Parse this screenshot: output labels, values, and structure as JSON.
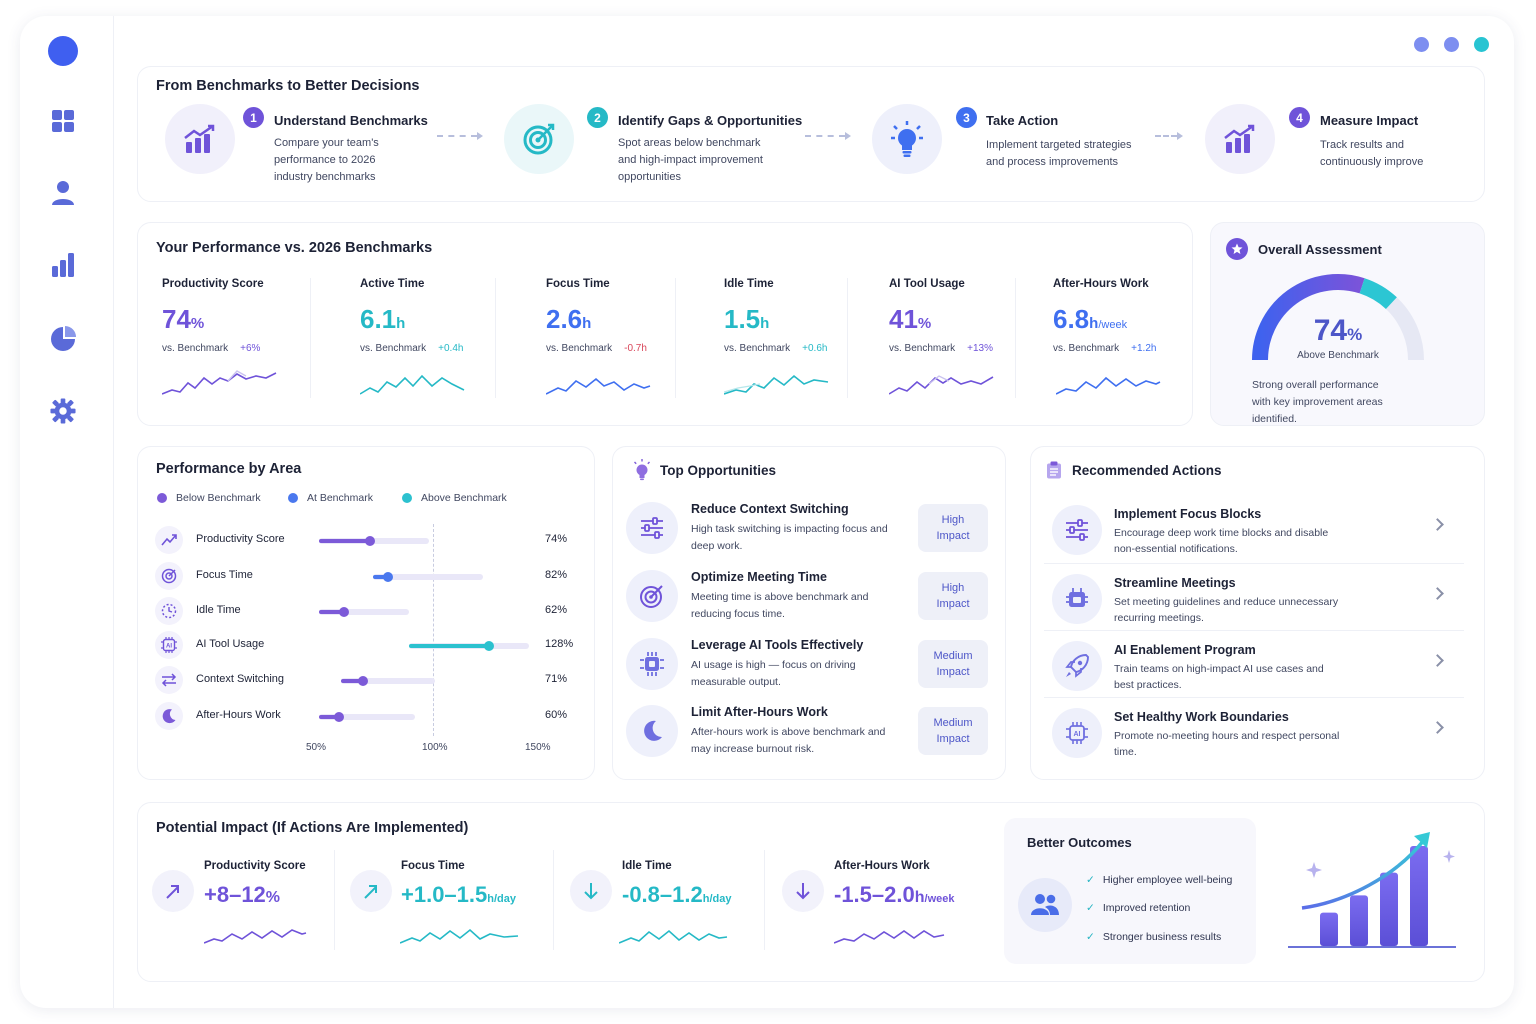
{
  "nav": {
    "icons": [
      "dashboard-grid-icon",
      "user-icon",
      "bar-chart-icon",
      "pie-chart-icon",
      "settings-gear-icon"
    ]
  },
  "window_dots": [
    "#7d8ef0",
    "#7d8ef0",
    "#28c4d2"
  ],
  "colors": {
    "purple": "#6f53d9",
    "blue": "#3f6ff0",
    "teal": "#25b9c6",
    "red": "#d9465a"
  },
  "benchmarks_flow": {
    "title": "From Benchmarks to Better Decisions",
    "steps": [
      {
        "num": "1",
        "title": "Understand Benchmarks",
        "desc_lines": [
          "Compare your team's",
          "performance to 2026",
          "industry benchmarks"
        ]
      },
      {
        "num": "2",
        "title": "Identify Gaps & Opportunities",
        "desc_lines": [
          "Spot areas below benchmark",
          "and high-impact improvement",
          "opportunities"
        ]
      },
      {
        "num": "3",
        "title": "Take Action",
        "desc_lines": [
          "Implement targeted strategies",
          "and process improvements"
        ]
      },
      {
        "num": "4",
        "title": "Measure Impact",
        "desc_lines": [
          "Track results and",
          "continuously improve"
        ]
      }
    ]
  },
  "performance": {
    "title": "Your Performance vs. 2026 Benchmarks",
    "vs_label": "vs. Benchmark",
    "metrics": [
      {
        "label": "Productivity Score",
        "value": "74",
        "unit": "%",
        "delta": "+6%"
      },
      {
        "label": "Active Time",
        "value": "6.1",
        "unit": "h",
        "delta": "+0.4h"
      },
      {
        "label": "Focus Time",
        "value": "2.6",
        "unit": "h",
        "delta": "-0.7h"
      },
      {
        "label": "Idle Time",
        "value": "1.5",
        "unit": "h",
        "delta": "+0.6h"
      },
      {
        "label": "AI Tool Usage",
        "value": "41",
        "unit": "%",
        "delta": "+13%"
      },
      {
        "label": "After-Hours Work",
        "value": "6.8",
        "unit": "h",
        "unit2": "/week",
        "delta": "+1.2h"
      }
    ]
  },
  "assessment": {
    "title": "Overall Assessment",
    "score": "74",
    "unit": "%",
    "score_fraction": 0.74,
    "status": "Above Benchmark",
    "desc_lines": [
      "Strong overall performance",
      "with key improvement areas",
      "identified."
    ]
  },
  "by_area": {
    "title": "Performance by Area",
    "legend": [
      "Below Benchmark",
      "At Benchmark",
      "Above Benchmark"
    ],
    "rows": [
      {
        "name": "Productivity Score",
        "pct": "74%",
        "value": 74,
        "status": "below"
      },
      {
        "name": "Focus Time",
        "pct": "82%",
        "value": 82,
        "status": "at"
      },
      {
        "name": "Idle Time",
        "pct": "62%",
        "value": 62,
        "status": "below"
      },
      {
        "name": "AI Tool Usage",
        "pct": "128%",
        "value": 128,
        "status": "above"
      },
      {
        "name": "Context Switching",
        "pct": "71%",
        "value": 71,
        "status": "below"
      },
      {
        "name": "After-Hours Work",
        "pct": "60%",
        "value": 60,
        "status": "below"
      }
    ],
    "axis": [
      "50%",
      "100%",
      "150%"
    ]
  },
  "opportunities": {
    "title": "Top Opportunities",
    "items": [
      {
        "title": "Reduce Context Switching",
        "desc": "High task switching is impacting focus and deep work.",
        "impact_lines": [
          "High",
          "Impact"
        ]
      },
      {
        "title": "Optimize Meeting Time",
        "desc": "Meeting time is above benchmark and reducing focus time.",
        "impact_lines": [
          "High",
          "Impact"
        ]
      },
      {
        "title": "Leverage AI Tools Effectively",
        "desc": "AI usage is high — focus on driving measurable output.",
        "impact_lines": [
          "Medium",
          "Impact"
        ]
      },
      {
        "title": "Limit After-Hours Work",
        "desc": "After-hours work is above benchmark and may increase burnout risk.",
        "impact_lines": [
          "Medium",
          "Impact"
        ]
      }
    ]
  },
  "actions": {
    "title": "Recommended Actions",
    "items": [
      {
        "title": "Implement Focus Blocks",
        "desc": "Encourage deep work time blocks and disable non-essential notifications."
      },
      {
        "title": "Streamline Meetings",
        "desc": "Set meeting guidelines and reduce unnecessary recurring meetings."
      },
      {
        "title": "AI Enablement Program",
        "desc": "Train teams on high-impact AI use cases and best practices."
      },
      {
        "title": "Set Healthy Work Boundaries",
        "desc": "Promote no-meeting hours and respect personal time."
      }
    ]
  },
  "impact": {
    "title": "Potential Impact (If Actions Are Implemented)",
    "items": [
      {
        "label": "Productivity Score",
        "value": "+8–12",
        "unit": "%"
      },
      {
        "label": "Focus Time",
        "value": "+1.0–1.5",
        "unit": "h/day"
      },
      {
        "label": "Idle Time",
        "value": "-0.8–1.2",
        "unit": "h/day"
      },
      {
        "label": "After-Hours Work",
        "value": "-1.5–2.0",
        "unit": "h",
        "unit2": "/week"
      }
    ]
  },
  "outcomes": {
    "title": "Better Outcomes",
    "items": [
      "Higher employee well-being",
      "Improved retention",
      "Stronger business results"
    ],
    "bars": [
      0.25,
      0.38,
      0.55,
      0.75
    ]
  }
}
